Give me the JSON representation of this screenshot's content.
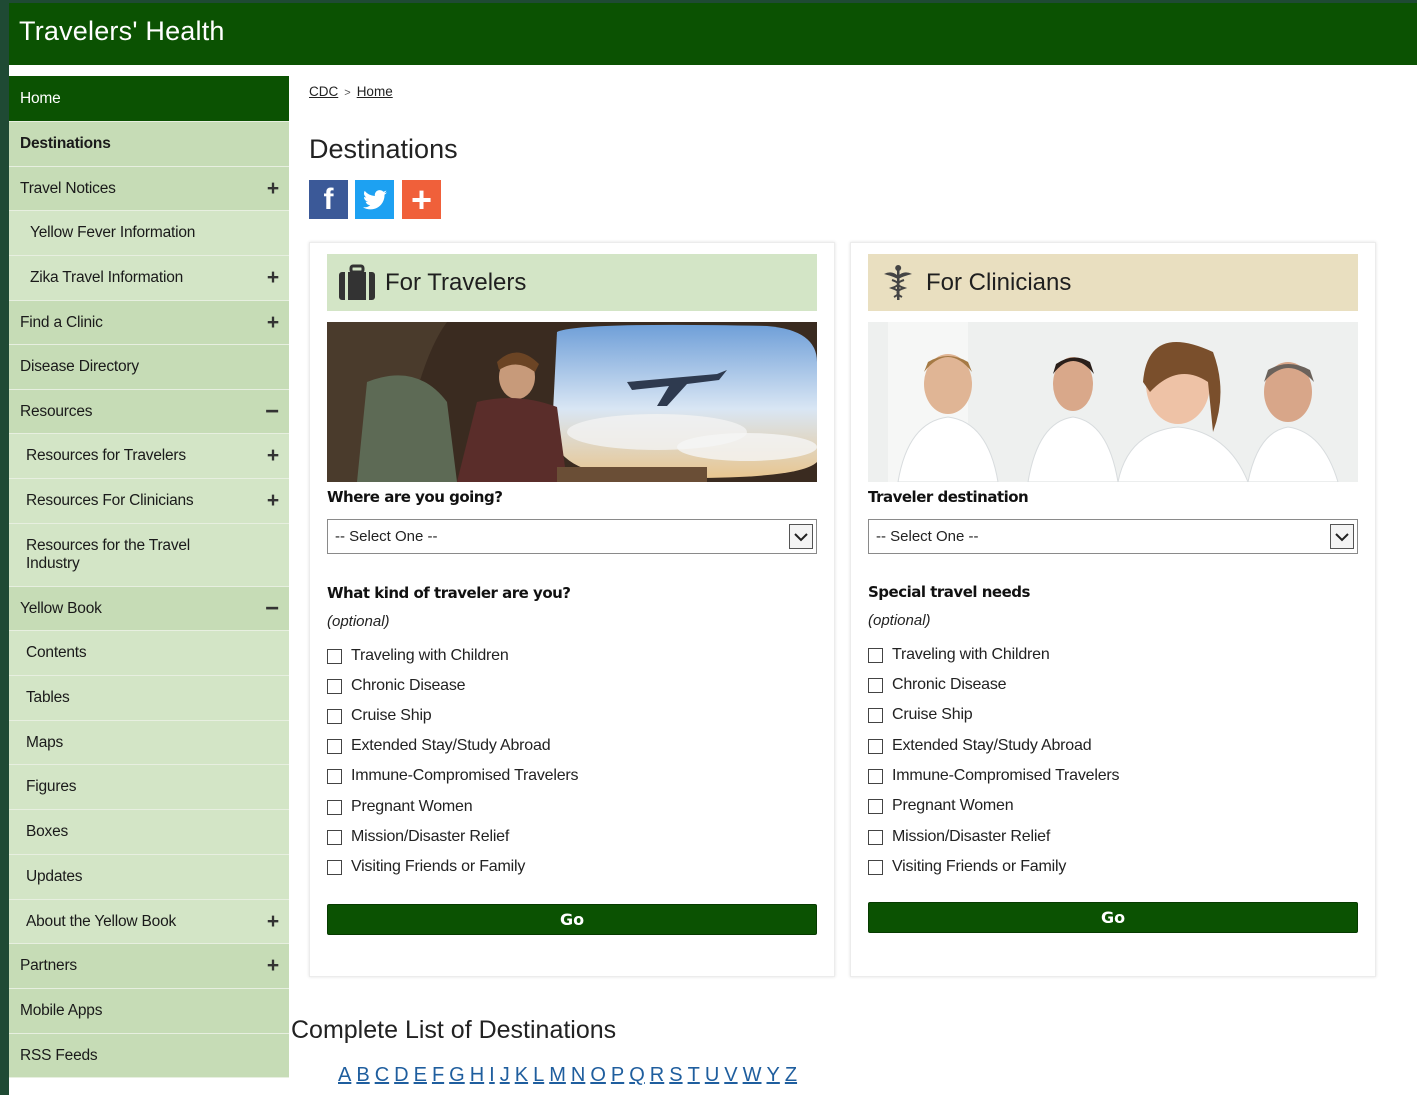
{
  "header": {
    "title": "Travelers' Health"
  },
  "sidebar": {
    "items": [
      {
        "label": "Home",
        "toggle": ""
      },
      {
        "label": "Destinations",
        "toggle": ""
      },
      {
        "label": "Travel Notices",
        "toggle": "+"
      },
      {
        "label": "Yellow Fever Information",
        "toggle": ""
      },
      {
        "label": "Zika Travel Information",
        "toggle": "+"
      },
      {
        "label": "Find a Clinic",
        "toggle": "+"
      },
      {
        "label": "Disease Directory",
        "toggle": ""
      },
      {
        "label": "Resources",
        "toggle": "−"
      },
      {
        "label": "Resources for Travelers",
        "toggle": "+"
      },
      {
        "label": "Resources For Clinicians",
        "toggle": "+"
      },
      {
        "label": "Resources for the Travel Industry",
        "toggle": ""
      },
      {
        "label": "Yellow Book",
        "toggle": "−"
      },
      {
        "label": "Contents",
        "toggle": ""
      },
      {
        "label": "Tables",
        "toggle": ""
      },
      {
        "label": "Maps",
        "toggle": ""
      },
      {
        "label": "Figures",
        "toggle": ""
      },
      {
        "label": "Boxes",
        "toggle": ""
      },
      {
        "label": "Updates",
        "toggle": ""
      },
      {
        "label": "About the Yellow Book",
        "toggle": "+"
      },
      {
        "label": "Partners",
        "toggle": "+"
      },
      {
        "label": "Mobile Apps",
        "toggle": ""
      },
      {
        "label": "RSS Feeds",
        "toggle": ""
      }
    ]
  },
  "breadcrumb": {
    "items": [
      "CDC",
      "Home"
    ],
    "separator": ">"
  },
  "page": {
    "title": "Destinations"
  },
  "social": {
    "facebook": "f",
    "twitter": "t",
    "share": "+"
  },
  "travelers": {
    "heading": "For Travelers",
    "question": "Where are you going?",
    "select_value": "-- Select One --",
    "kind_label": "What kind of traveler are you?",
    "optional": "(optional)",
    "options": [
      "Traveling with Children",
      "Chronic Disease",
      "Cruise Ship",
      "Extended Stay/Study Abroad",
      "Immune-Compromised Travelers",
      "Pregnant Women",
      "Mission/Disaster Relief",
      "Visiting Friends or Family"
    ],
    "go_label": "Go"
  },
  "clinicians": {
    "heading": "For Clinicians",
    "question": "Traveler destination",
    "select_value": "-- Select One --",
    "kind_label": "Special travel needs",
    "optional": "(optional)",
    "options": [
      "Traveling with Children",
      "Chronic Disease",
      "Cruise Ship",
      "Extended Stay/Study Abroad",
      "Immune-Compromised Travelers",
      "Pregnant Women",
      "Mission/Disaster Relief",
      "Visiting Friends or Family"
    ],
    "go_label": "Go"
  },
  "complete_list": {
    "title": "Complete List of Destinations",
    "letters": [
      "A",
      "B",
      "C",
      "D",
      "E",
      "F",
      "G",
      "H",
      "I",
      "J",
      "K",
      "L",
      "M",
      "N",
      "O",
      "P",
      "Q",
      "R",
      "S",
      "T",
      "U",
      "V",
      "W",
      "Y",
      "Z"
    ]
  },
  "colors": {
    "brand_green": "#0b5202",
    "nav_bg": "#c6dcb6",
    "traveler_head": "#d3e5c6",
    "clinician_head": "#e9dfc0",
    "link_blue": "#1f5e9e"
  }
}
